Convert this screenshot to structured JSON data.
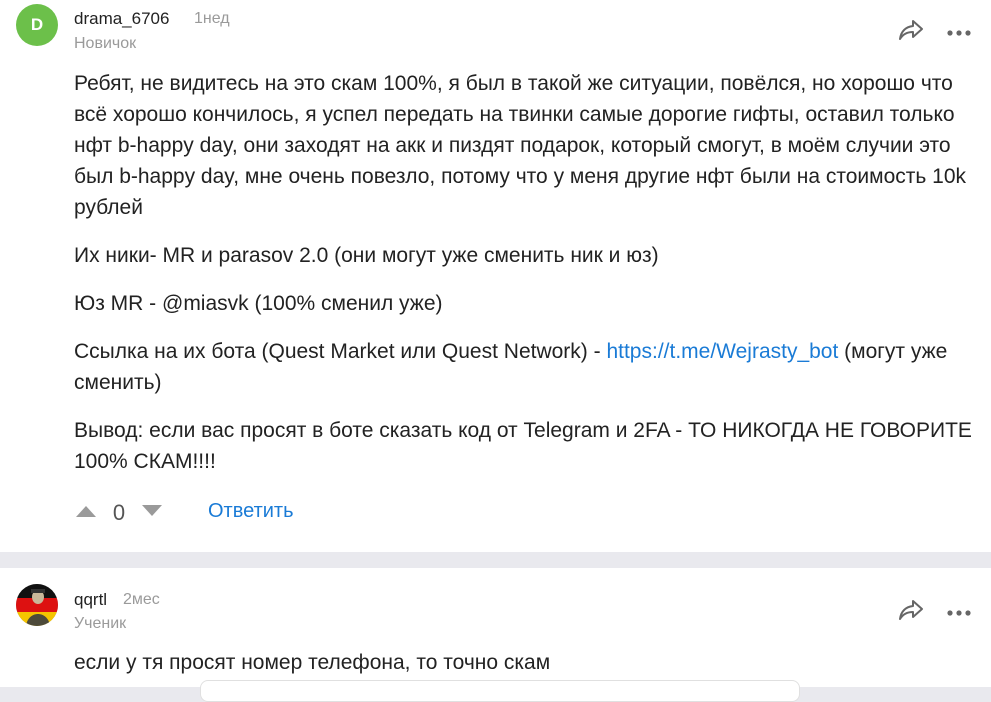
{
  "comments": [
    {
      "avatar_letter": "D",
      "author": "drama_6706",
      "time": "1нед",
      "rank": "Новичок",
      "paragraphs": {
        "p1": "Ребят, не видитесь на это скам 100%, я был в такой же ситуации, повёлся, но хорошо что всё хорошо кончилось, я успел передать на твинки самые дорогие гифты, оставил только нфт b-happy day, они заходят на акк и пиздят подарок, который смогут, в моём случии это был b-happy day, мне очень повезло, потому что у меня другие нфт были на стоимость 10k рублей",
        "p2": "Их ники- MR и parasov 2.0 (они могут уже сменить ник и юз)",
        "p3": "Юз MR - @miasvk (100% сменил уже)",
        "p4_before": "Ссылка на их бота (Quest Market или Quest Network) - ",
        "p4_link": "https://t.me/Wejrasty_bot",
        "p4_after": " (могут уже сменить)",
        "p5": "Вывод: если вас просят в боте сказать код от Telegram и 2FA - ТО НИКОГДА НЕ ГОВОРИТЕ 100% СКАМ!!!!"
      },
      "votes": "0",
      "reply_label": "Ответить",
      "icons": {
        "share": "share-icon",
        "more": "more-icon",
        "upvote": "upvote-icon",
        "downvote": "downvote-icon"
      }
    },
    {
      "author": "qqrtl",
      "time": "2мес",
      "rank": "Ученик",
      "text": "если у тя просят номер телефона, то точно скам",
      "icons": {
        "share": "share-icon",
        "more": "more-icon"
      }
    }
  ],
  "colors": {
    "link": "#1a7bd6",
    "avatar_green": "#6cc04a",
    "muted": "#9a9a9a",
    "background": "#e9e9ee"
  }
}
